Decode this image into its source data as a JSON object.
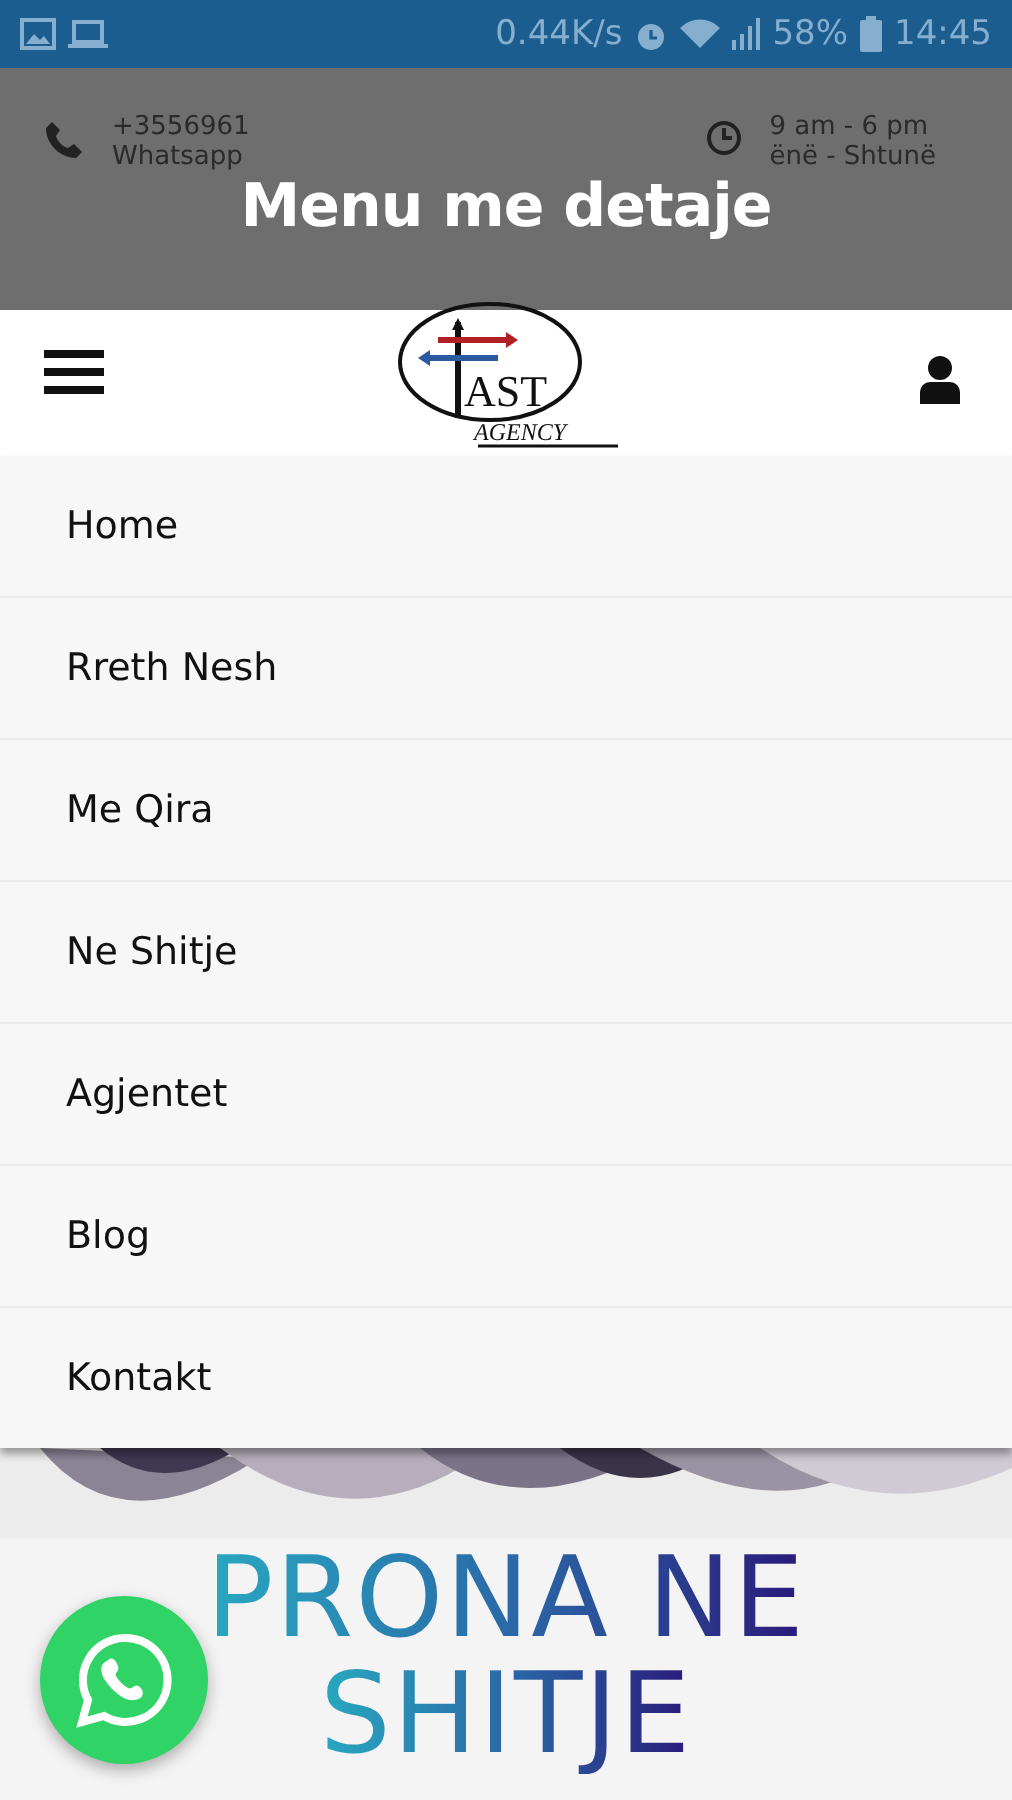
{
  "status_bar": {
    "speed": "0.44K/s",
    "battery": "58%",
    "time": "14:45"
  },
  "caption": "Menu me detaje",
  "contact": [
    {
      "kind": "phone",
      "lines": [
        "+3556961",
        "Whatsapp"
      ]
    },
    {
      "kind": "clock",
      "lines": [
        "9 am - 6 pm",
        "ënë - Shtunë"
      ]
    }
  ],
  "logo": {
    "word": "AST",
    "tagline": "AGENCY"
  },
  "menu": {
    "items": [
      "Home",
      "Rreth Nesh",
      "Me Qira",
      "Ne Shitje",
      "Agjentet",
      "Blog",
      "Kontakt"
    ]
  },
  "banner": {
    "lines": [
      "PRONA NE",
      "SHITJE"
    ]
  }
}
